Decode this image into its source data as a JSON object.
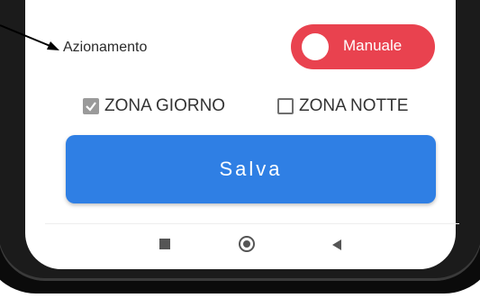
{
  "settings": {
    "drive_label": "Azionamento",
    "mode_toggle_label": "Manuale",
    "mode_toggle_color": "#e9424f"
  },
  "zones": {
    "day": {
      "label": "ZONA GIORNO",
      "checked": true
    },
    "night": {
      "label": "ZONA NOTTE",
      "checked": false
    }
  },
  "actions": {
    "save_label": "Salva",
    "save_color": "#2f7fe4"
  },
  "navbar": {
    "icons": [
      "recents-square-icon",
      "home-circle-icon",
      "back-triangle-icon"
    ]
  }
}
